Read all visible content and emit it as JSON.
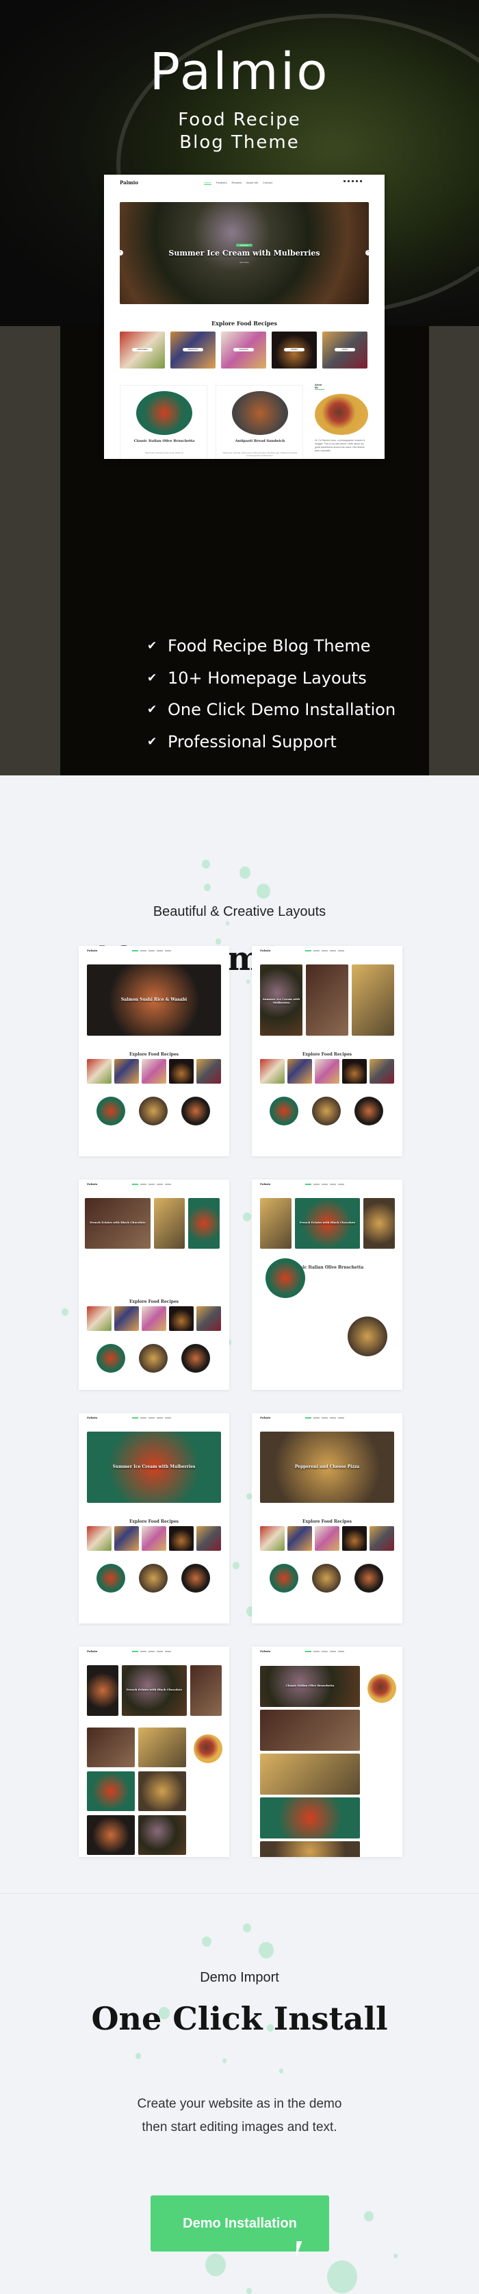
{
  "hero": {
    "brand": "Palmio",
    "subtitle_line1": "Food Recipe",
    "subtitle_line2": "Blog Theme"
  },
  "mockup": {
    "logo": "Palmio",
    "nav": [
      "Home",
      "Features",
      "Recipes",
      "About Me",
      "Contact"
    ],
    "social_icons": [
      "facebook-icon",
      "twitter-icon",
      "instagram-icon",
      "youtube-icon",
      "search-icon"
    ],
    "slider": {
      "badge": "Desserts",
      "title": "Summer Ice Cream with Mulberries",
      "read_more": "View More"
    },
    "explore_heading": "Explore Food Recipes",
    "categories": [
      "Appetizers",
      "Breakfast",
      "Desserts",
      "Drinks",
      "Mains"
    ],
    "posts": [
      {
        "title": "Classic Italian Olive Bruschetta",
        "excerpt": "Maecenas vehicula metus amet, finibus at"
      },
      {
        "title": "Antipasti Bread Sandwich",
        "excerpt": "Maecenas vehicula metus amet, finibus at justo vulputate eget. Pellente porta felis id erat egestas condimentum."
      }
    ],
    "about": {
      "heading": "About Me",
      "text": "Hi, I'm Rachel Lines, a photographer, traveler & blogger. This is my site where I write about my great adventures around the world. Nec finibus justo vulputate."
    }
  },
  "features": [
    "Food Recipe Blog Theme",
    "10+ Homepage Layouts",
    "One Click Demo Installation",
    "Professional Support"
  ],
  "layouts_section": {
    "caption": "Beautiful & Creative Layouts",
    "heading": "10+ Homepages"
  },
  "homepages": [
    {
      "logo": "Palmio",
      "hero_title": "Salmon Sushi Rice & Wasabi",
      "explore": "Explore Food Recipes"
    },
    {
      "logo": "Palmio",
      "hero_title": "Summer Ice Cream with Mulberries",
      "explore": "Explore Food Recipes"
    },
    {
      "logo": "Palmio",
      "hero_title": "French Eclairs with Black Chocolate",
      "explore": "Explore Food Recipes"
    },
    {
      "logo": "Palmio",
      "hero_title": "French Eclairs with Black Chocolate",
      "explore": "Classic Italian Olive Bruschetta"
    },
    {
      "logo": "Palmio",
      "hero_title": "Summer Ice Cream with Mulberries",
      "explore": "Explore Food Recipes"
    },
    {
      "logo": "Palmio",
      "hero_title": "Pepperoni and Cheese Pizza",
      "explore": "Explore Food Recipes"
    },
    {
      "logo": "Palmio",
      "hero_title": "French Eclairs with Black Chocolate",
      "explore": ""
    },
    {
      "logo": "Palmio",
      "hero_title": "Classic Italian Olive Bruschetta",
      "explore": ""
    }
  ],
  "demo_section": {
    "caption": "Demo Import",
    "heading": "One Click Install",
    "text_line1": "Create your website as in the demo",
    "text_line2": "then start editing images and text.",
    "button": "Demo Installation"
  },
  "colors": {
    "accent": "#52d37a",
    "dark": "#0a0906",
    "light_bg": "#f1f3f7"
  }
}
